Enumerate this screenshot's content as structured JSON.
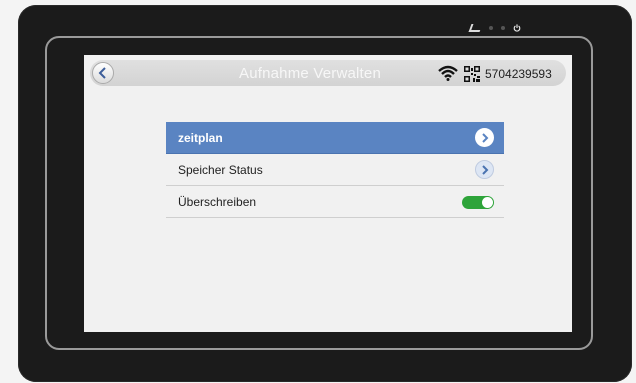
{
  "header": {
    "title": "Aufnahme Verwalten",
    "device_code": "5704239593"
  },
  "icons": {
    "back": "chevron-left-icon",
    "wifi": "wifi-icon",
    "qr": "qr-code-icon",
    "row_chevron": "chevron-right-icon",
    "power": "power-icon"
  },
  "menu": {
    "items": [
      {
        "label": "zeitplan",
        "control": "chevron",
        "selected": true
      },
      {
        "label": "Speicher Status",
        "control": "chevron",
        "selected": false
      },
      {
        "label": "Überschreiben",
        "control": "toggle",
        "on": true
      }
    ]
  },
  "colors": {
    "selected_row": "#5a84c2",
    "toggle_on": "#2ea43a",
    "device_frame": "#1b1b1b"
  }
}
